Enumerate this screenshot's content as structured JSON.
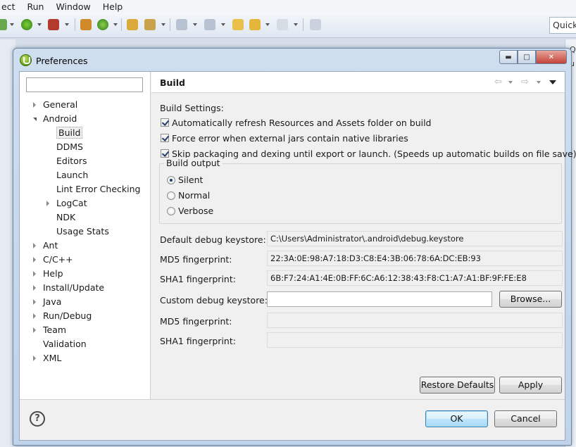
{
  "menubar": [
    "ect",
    "Run",
    "Window",
    "Help"
  ],
  "quick_access": "Quick",
  "right_panel_labels": [
    "Qu",
    "u"
  ],
  "dialog": {
    "title": "Preferences",
    "filter_value": ""
  },
  "tree": [
    {
      "label": "General",
      "state": "collapsed",
      "level": 0
    },
    {
      "label": "Android",
      "state": "expanded",
      "level": 0
    },
    {
      "label": "Build",
      "state": "leaf",
      "level": 1,
      "selected": true
    },
    {
      "label": "DDMS",
      "state": "leaf",
      "level": 1
    },
    {
      "label": "Editors",
      "state": "leaf",
      "level": 1
    },
    {
      "label": "Launch",
      "state": "leaf",
      "level": 1
    },
    {
      "label": "Lint Error Checking",
      "state": "leaf",
      "level": 1
    },
    {
      "label": "LogCat",
      "state": "collapsed",
      "level": 1
    },
    {
      "label": "NDK",
      "state": "leaf",
      "level": 1
    },
    {
      "label": "Usage Stats",
      "state": "leaf",
      "level": 1
    },
    {
      "label": "Ant",
      "state": "collapsed",
      "level": 0
    },
    {
      "label": "C/C++",
      "state": "collapsed",
      "level": 0
    },
    {
      "label": "Help",
      "state": "collapsed",
      "level": 0
    },
    {
      "label": "Install/Update",
      "state": "collapsed",
      "level": 0
    },
    {
      "label": "Java",
      "state": "collapsed",
      "level": 0
    },
    {
      "label": "Run/Debug",
      "state": "collapsed",
      "level": 0
    },
    {
      "label": "Team",
      "state": "collapsed",
      "level": 0
    },
    {
      "label": "Validation",
      "state": "leaf",
      "level": 0
    },
    {
      "label": "XML",
      "state": "collapsed",
      "level": 0
    }
  ],
  "page": {
    "title": "Build",
    "settings_label": "Build Settings:",
    "checkboxes": [
      {
        "label": "Automatically refresh Resources and Assets folder on build",
        "checked": true
      },
      {
        "label": "Force error when external jars contain native libraries",
        "checked": true
      },
      {
        "label": "Skip packaging and dexing until export or launch. (Speeds up automatic builds on file save)",
        "checked": true
      }
    ],
    "build_output": {
      "label": "Build output",
      "options": [
        {
          "label": "Silent",
          "selected": true
        },
        {
          "label": "Normal",
          "selected": false
        },
        {
          "label": "Verbose",
          "selected": false
        }
      ]
    },
    "default_keystore_label": "Default debug keystore:",
    "default_keystore_value": "C:\\Users\\Administrator\\.android\\debug.keystore",
    "md5_label": "MD5 fingerprint:",
    "md5_value": "22:3A:0E:98:A7:18:D3:C8:E4:3B:06:78:6A:DC:EB:93",
    "sha1_label": "SHA1 fingerprint:",
    "sha1_value": "6B:F7:24:A1:4E:0B:FF:6C:A6:12:38:43:F8:C1:A7:A1:BF:9F:FE:E8",
    "custom_keystore_label": "Custom debug keystore:",
    "custom_keystore_value": "",
    "browse_label": "Browse...",
    "custom_md5_label": "MD5 fingerprint:",
    "custom_md5_value": "",
    "custom_sha1_label": "SHA1 fingerprint:",
    "custom_sha1_value": "",
    "restore_defaults_label": "Restore Defaults",
    "apply_label": "Apply"
  },
  "footer": {
    "ok_label": "OK",
    "cancel_label": "Cancel"
  },
  "colors": {
    "dialog_frame": "#bfd3ea",
    "accent_check": "#24406b",
    "default_button": "#3c7fb1"
  }
}
